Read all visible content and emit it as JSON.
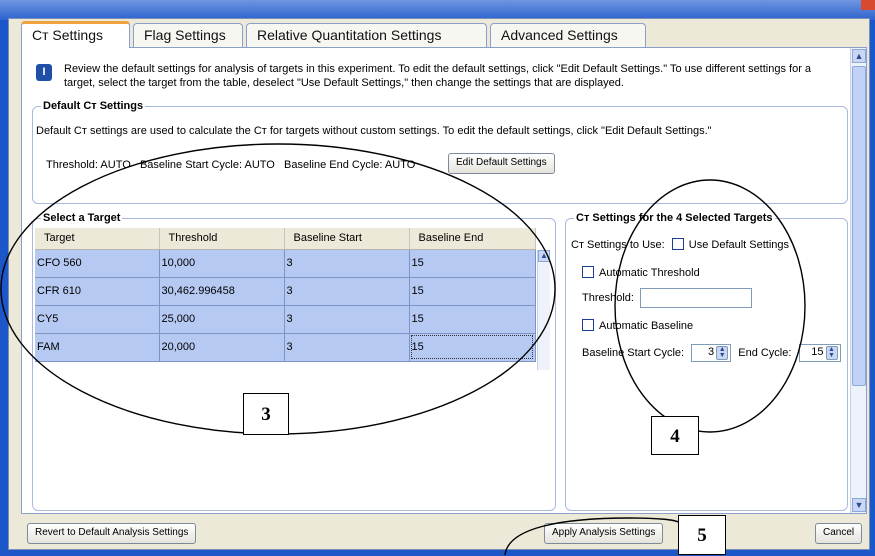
{
  "tabs": [
    {
      "label": "Cт Settings",
      "active": true
    },
    {
      "label": "Flag Settings",
      "active": false
    },
    {
      "label": "Relative Quantitation Settings",
      "active": false
    },
    {
      "label": "Advanced Settings",
      "active": false
    }
  ],
  "info_text": "Review the default settings for analysis of targets in this experiment. To edit the default settings, click \"Edit Default Settings.\" To use different settings for a target, select the target from the table, deselect \"Use Default Settings,\" then change the settings that are displayed.",
  "default_group": {
    "legend": "Default Cт Settings",
    "description": "Default Cт settings are used to calculate the Cт for targets without custom settings. To edit the default settings, click \"Edit Default Settings.\"",
    "summary": "Threshold: AUTO   Baseline Start Cycle: AUTO   Baseline End Cycle: AUTO",
    "edit_button": "Edit Default Settings"
  },
  "target_group": {
    "legend": "Select a Target",
    "columns": [
      "Target",
      "Threshold",
      "Baseline Start",
      "Baseline End"
    ],
    "rows": [
      [
        "CFO 560",
        "10,000",
        "3",
        "15"
      ],
      [
        "CFR 610",
        "30,462.996458",
        "3",
        "15"
      ],
      [
        "CY5",
        "25,000",
        "3",
        "15"
      ],
      [
        "FAM",
        "20,000",
        "3",
        "15"
      ]
    ]
  },
  "selected_group": {
    "legend": "Cт Settings for the 4 Selected Targets",
    "use_label": "Cт Settings to Use:",
    "use_default_label": "Use Default Settings",
    "auto_threshold_label": "Automatic Threshold",
    "threshold_label": "Threshold:",
    "threshold_value": "",
    "auto_baseline_label": "Automatic Baseline",
    "baseline_start_label": "Baseline Start Cycle:",
    "baseline_start_value": "3",
    "end_cycle_label": "End Cycle:",
    "end_cycle_value": "15"
  },
  "footer": {
    "revert_button": "Revert to Default Analysis Settings",
    "apply_button": "Apply Analysis Settings",
    "cancel_button": "Cancel"
  },
  "callouts": [
    "3",
    "4",
    "5"
  ]
}
